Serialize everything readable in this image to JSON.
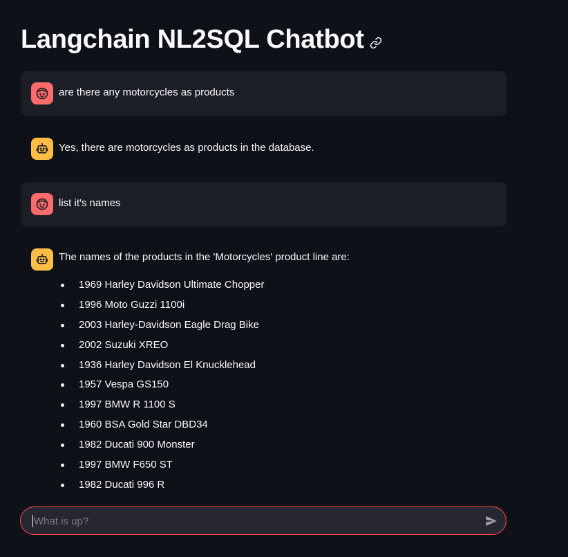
{
  "header": {
    "title": "Langchain NL2SQL Chatbot"
  },
  "messages": [
    {
      "role": "user",
      "text": "are there any motorcycles as products"
    },
    {
      "role": "assistant",
      "text": "Yes, there are motorcycles as products in the database."
    },
    {
      "role": "user",
      "text": "list it's names"
    },
    {
      "role": "assistant",
      "text": "The names of the products in the 'Motorcycles' product line are:"
    }
  ],
  "products": [
    "1969 Harley Davidson Ultimate Chopper",
    "1996 Moto Guzzi 1100i",
    "2003 Harley-Davidson Eagle Drag Bike",
    "2002 Suzuki XREO",
    "1936 Harley Davidson El Knucklehead",
    "1957 Vespa GS150",
    "1997 BMW R 1100 S",
    "1960 BSA Gold Star DBD34",
    "1982 Ducati 900 Monster",
    "1997 BMW F650 ST",
    "1982 Ducati 996 R"
  ],
  "chat_input": {
    "placeholder": "What is up?",
    "value": ""
  },
  "colors": {
    "background": "#0e1117",
    "user_avatar": "#ff6b6b",
    "assistant_avatar": "#ffbd45",
    "input_border": "#ff4b4b"
  },
  "icons": {
    "title_anchor": "link-icon",
    "user_avatar": "user-face-icon",
    "assistant_avatar": "robot-icon",
    "send": "send-icon"
  }
}
